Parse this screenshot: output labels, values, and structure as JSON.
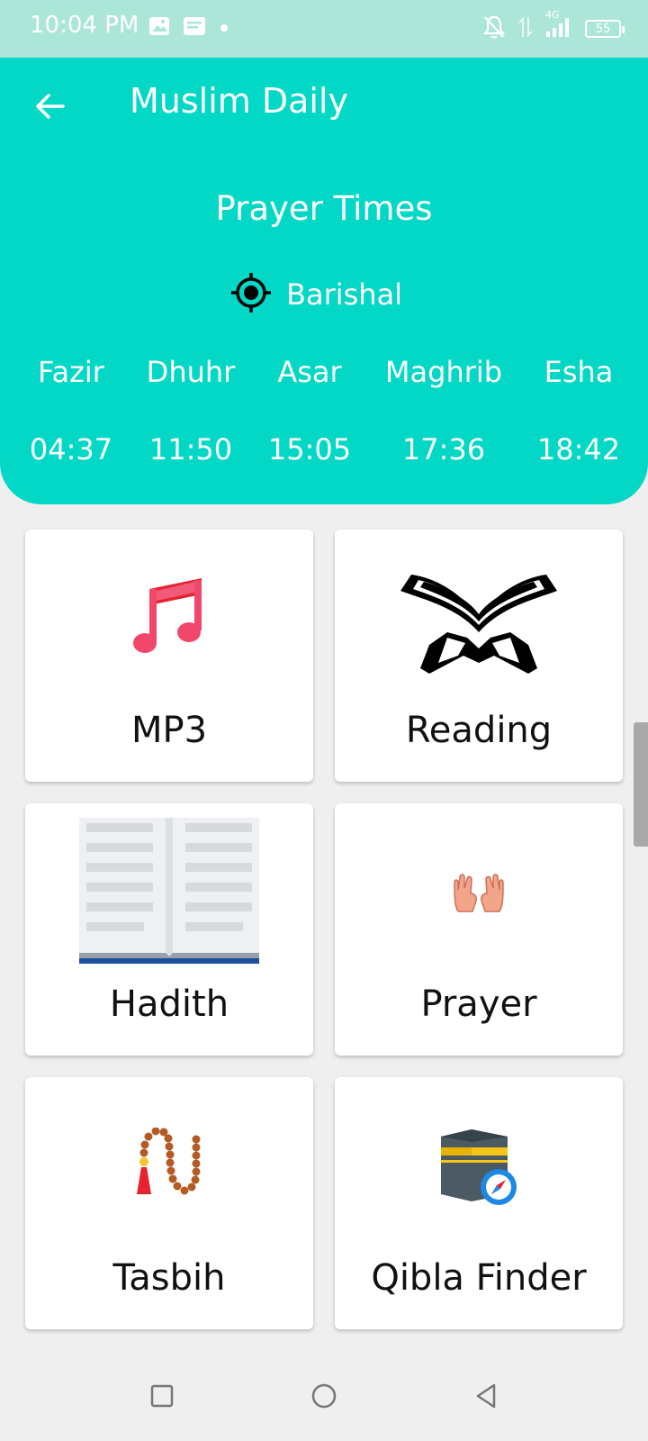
{
  "status_bar": {
    "time": "10:04 PM",
    "battery": "55",
    "network": "4G",
    "left_icons": [
      "image-icon",
      "message-icon",
      "dot-icon"
    ],
    "right_icons": [
      "bell-off-icon",
      "data-arrows-icon",
      "signal-icon",
      "battery-icon"
    ]
  },
  "header": {
    "title": "Muslim Daily",
    "back_icon": "arrow-left-icon",
    "section_title": "Prayer Times",
    "location_icon": "location-target-icon",
    "location": "Barishal",
    "accent_color": "#02d8c5",
    "prayers": [
      {
        "name": "Fazir",
        "time": "04:37"
      },
      {
        "name": "Dhuhr",
        "time": "11:50"
      },
      {
        "name": "Asar",
        "time": "15:05"
      },
      {
        "name": "Maghrib",
        "time": "17:36"
      },
      {
        "name": "Esha",
        "time": "18:42"
      }
    ]
  },
  "menu": [
    {
      "label": "MP3",
      "icon": "music-note-icon"
    },
    {
      "label": "Reading",
      "icon": "quran-stand-icon"
    },
    {
      "label": "Hadith",
      "icon": "open-book-icon"
    },
    {
      "label": "Prayer",
      "icon": "praying-hands-icon"
    },
    {
      "label": "Tasbih",
      "icon": "prayer-beads-icon"
    },
    {
      "label": "Qibla Finder",
      "icon": "kaaba-compass-icon"
    }
  ],
  "nav_bar": {
    "buttons": [
      "recents-square-icon",
      "home-circle-icon",
      "back-triangle-icon"
    ]
  }
}
